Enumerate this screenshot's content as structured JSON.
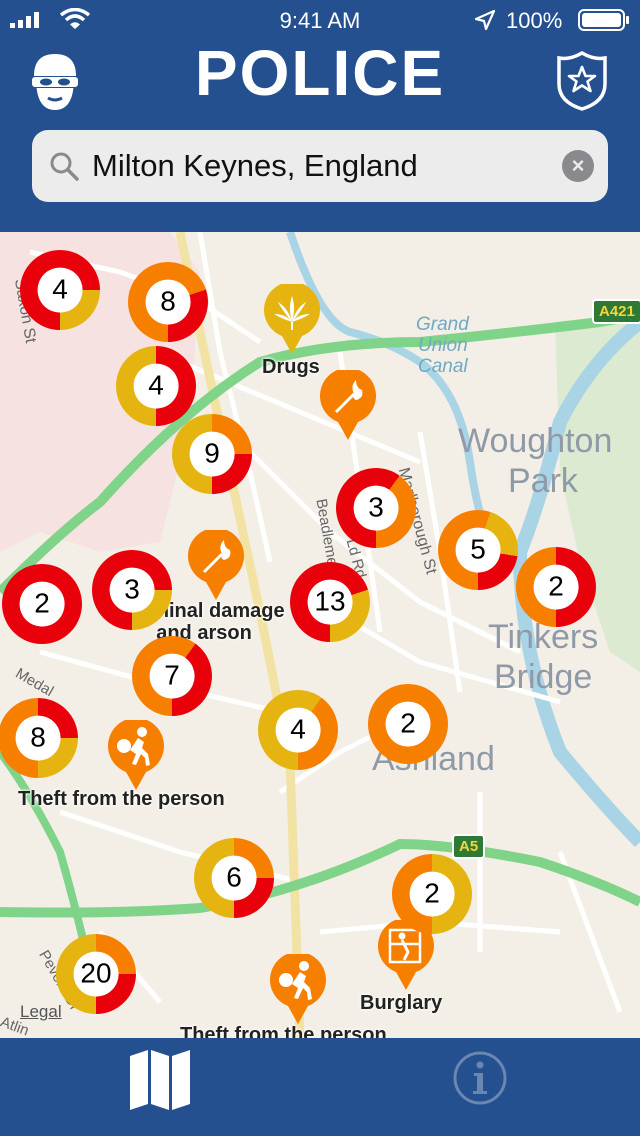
{
  "status_bar": {
    "time": "9:41 AM",
    "battery": "100%",
    "icons": [
      "signal-icon",
      "wifi-icon",
      "location-arrow-icon",
      "battery-icon"
    ]
  },
  "header": {
    "title": "POLICE",
    "left_icon": "robber-mask-icon",
    "right_icon": "police-badge-icon"
  },
  "search": {
    "value": "Milton Keynes, England",
    "icon": "magnifier-icon",
    "clear_icon": "clear-icon"
  },
  "map": {
    "legal": "Legal",
    "place_labels": [
      "Woughton",
      "Park",
      "Tinkers",
      "Bridge",
      "Ashland",
      "Grand",
      "Union",
      "Canal"
    ],
    "street_labels": [
      "Saxon St",
      "Beadlemead",
      "Marlborough St",
      "Ld Rd",
      "Medal",
      "Pevers Dr",
      "Atlin"
    ],
    "road_shields": [
      "A421",
      "A5"
    ],
    "clusters": [
      {
        "count": "4",
        "colors": [
          "#e8000b",
          "#e6b411"
        ],
        "share": 0.75
      },
      {
        "count": "8",
        "colors": [
          "#f77f00",
          "#e8000b"
        ],
        "share": 0.7
      },
      {
        "count": "4",
        "colors": [
          "#e6b411",
          "#e8000b"
        ],
        "share": 0.5
      },
      {
        "count": "9",
        "colors": [
          "#e6b411",
          "#f77f00",
          "#e8000b"
        ],
        "share": 0.5
      },
      {
        "count": "3",
        "colors": [
          "#e8000b",
          "#f77f00"
        ],
        "share": 0.6
      },
      {
        "count": "5",
        "colors": [
          "#f77f00",
          "#e6b411",
          "#e8000b"
        ],
        "share": 0.55
      },
      {
        "count": "2",
        "colors": [
          "#f77f00",
          "#e8000b"
        ],
        "share": 0.5
      },
      {
        "count": "2",
        "colors": [
          "#e8000b"
        ],
        "share": 1
      },
      {
        "count": "3",
        "colors": [
          "#e8000b",
          "#e6b411"
        ],
        "share": 0.75
      },
      {
        "count": "13",
        "colors": [
          "#e8000b",
          "#e6b411"
        ],
        "share": 0.7
      },
      {
        "count": "7",
        "colors": [
          "#f77f00",
          "#e8000b"
        ],
        "share": 0.6
      },
      {
        "count": "8",
        "colors": [
          "#f77f00",
          "#e8000b",
          "#e6b411"
        ],
        "share": 0.5
      },
      {
        "count": "4",
        "colors": [
          "#e6b411",
          "#f77f00"
        ],
        "share": 0.6
      },
      {
        "count": "2",
        "colors": [
          "#f77f00"
        ],
        "share": 1
      },
      {
        "count": "6",
        "colors": [
          "#e6b411",
          "#f77f00",
          "#e8000b"
        ],
        "share": 0.5
      },
      {
        "count": "2",
        "colors": [
          "#f77f00",
          "#e6b411"
        ],
        "share": 0.5
      },
      {
        "count": "20",
        "colors": [
          "#e6b411",
          "#f77f00",
          "#e8000b"
        ],
        "share": 0.5
      }
    ],
    "pins": [
      {
        "label": "Drugs",
        "icon": "cannabis-leaf-icon",
        "color": "#e6b411"
      },
      {
        "label": "",
        "icon": "fire-match-icon",
        "color": "#f77f00"
      },
      {
        "label": "Criminal damage and arson",
        "icon": "fire-match-icon",
        "color": "#f77f00"
      },
      {
        "label": "Theft from the person",
        "icon": "running-thief-icon",
        "color": "#f77f00"
      },
      {
        "label": "Burglary",
        "icon": "burglar-window-icon",
        "color": "#f77f00"
      },
      {
        "label": "Theft from the person",
        "icon": "running-thief-icon",
        "color": "#f77f00"
      }
    ]
  },
  "tab_bar": {
    "tabs": [
      {
        "icon": "map-icon",
        "active": true
      },
      {
        "icon": "info-icon",
        "active": false
      }
    ]
  },
  "colors": {
    "brand": "#24508f",
    "red": "#e8000b",
    "orange": "#f77f00",
    "yellow": "#e6b411"
  }
}
